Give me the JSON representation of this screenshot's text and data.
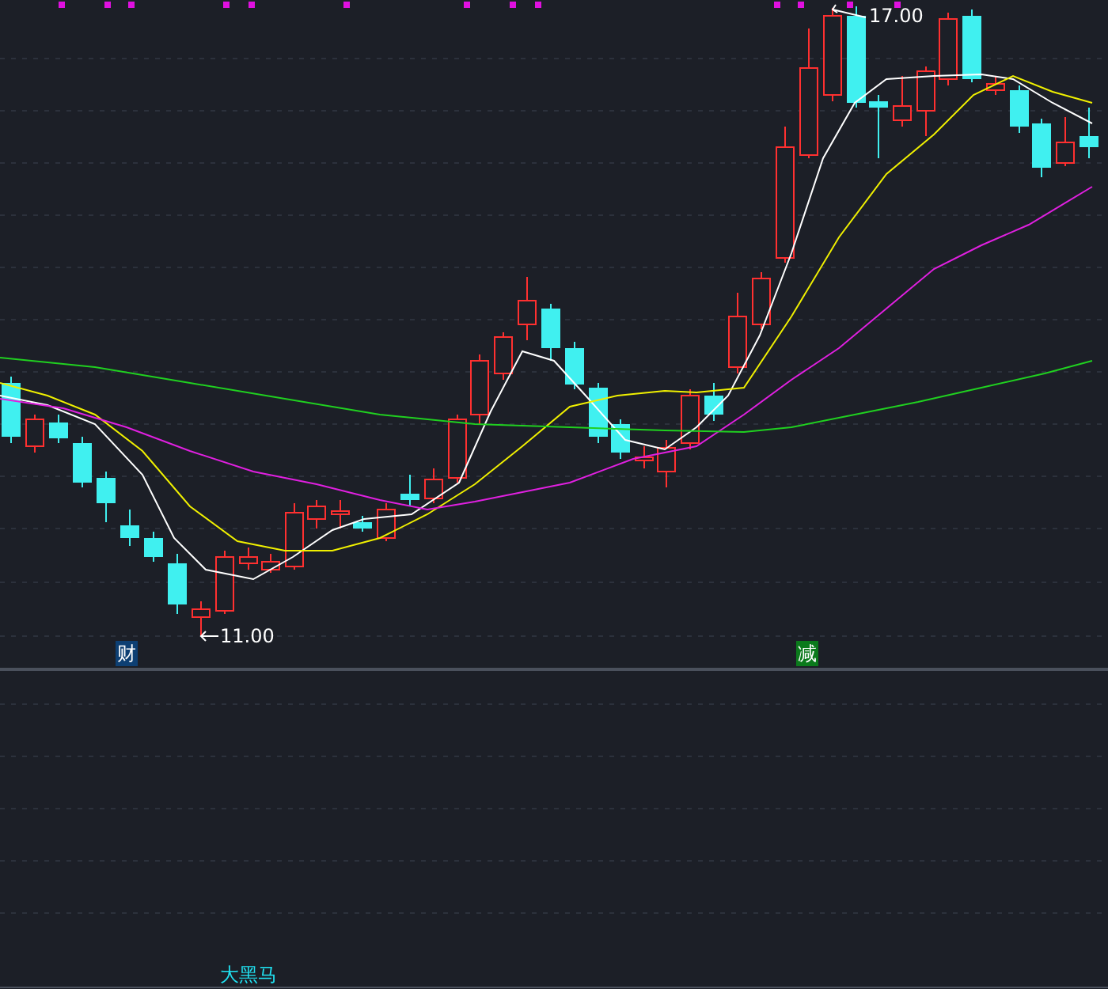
{
  "main_chart": {
    "high_marker": "17.00",
    "low_marker": "11.00",
    "signals": [
      {
        "label": "财",
        "color": "#0d3f73"
      },
      {
        "label": "减",
        "color": "#0b7a1c"
      }
    ]
  },
  "indicator_panel": {
    "label": "大黑马"
  }
}
